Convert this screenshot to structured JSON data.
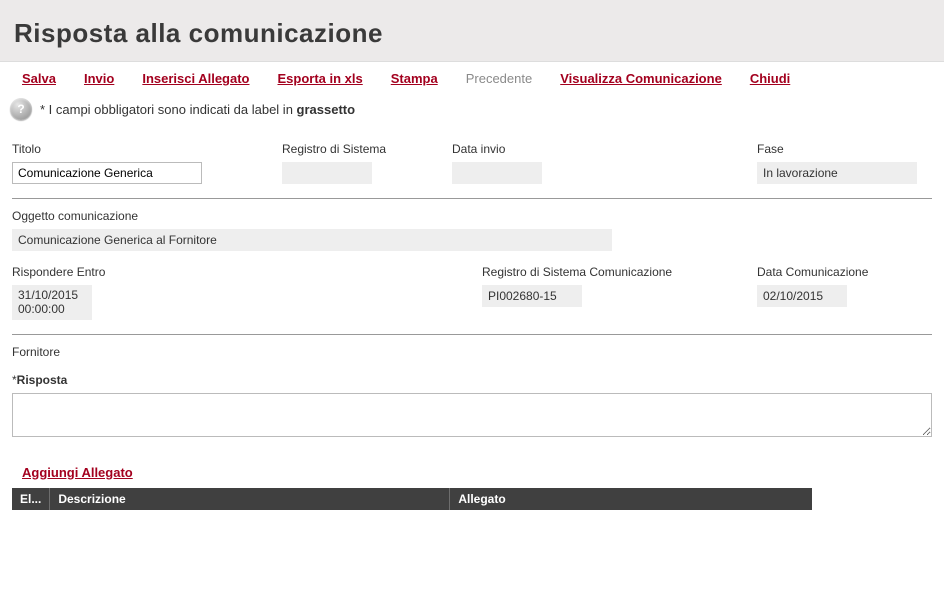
{
  "header": {
    "title": "Risposta alla comunicazione"
  },
  "toolbar": {
    "salva": "Salva",
    "invio": "Invio",
    "inserisci_allegato": "Inserisci Allegato",
    "esporta_xls": "Esporta in xls",
    "stampa": "Stampa",
    "precedente": "Precedente",
    "visualizza_comunicazione": "Visualizza Comunicazione",
    "chiudi": "Chiudi"
  },
  "help": {
    "icon": "?",
    "text_prefix": "* I campi obbligatori sono indicati da label in ",
    "text_bold": "grassetto"
  },
  "fields": {
    "titolo": {
      "label": "Titolo",
      "value": "Comunicazione Generica"
    },
    "registro_sistema": {
      "label": "Registro di Sistema",
      "value": ""
    },
    "data_invio": {
      "label": "Data invio",
      "value": ""
    },
    "fase": {
      "label": "Fase",
      "value": "In lavorazione"
    },
    "oggetto": {
      "label": "Oggetto comunicazione",
      "value": "Comunicazione Generica al Fornitore"
    },
    "rispondere_entro": {
      "label": "Rispondere Entro",
      "value": "31/10/2015\n00:00:00"
    },
    "registro_sistema_com": {
      "label": "Registro di Sistema Comunicazione",
      "value": "PI002680-15"
    },
    "data_comunicazione": {
      "label": "Data Comunicazione",
      "value": "02/10/2015"
    },
    "fornitore": {
      "label": "Fornitore",
      "value": ""
    },
    "risposta": {
      "label": "Risposta",
      "value": ""
    }
  },
  "attachments": {
    "add_link": "Aggiungi Allegato",
    "columns": {
      "el": "El...",
      "descrizione": "Descrizione",
      "allegato": "Allegato"
    }
  }
}
